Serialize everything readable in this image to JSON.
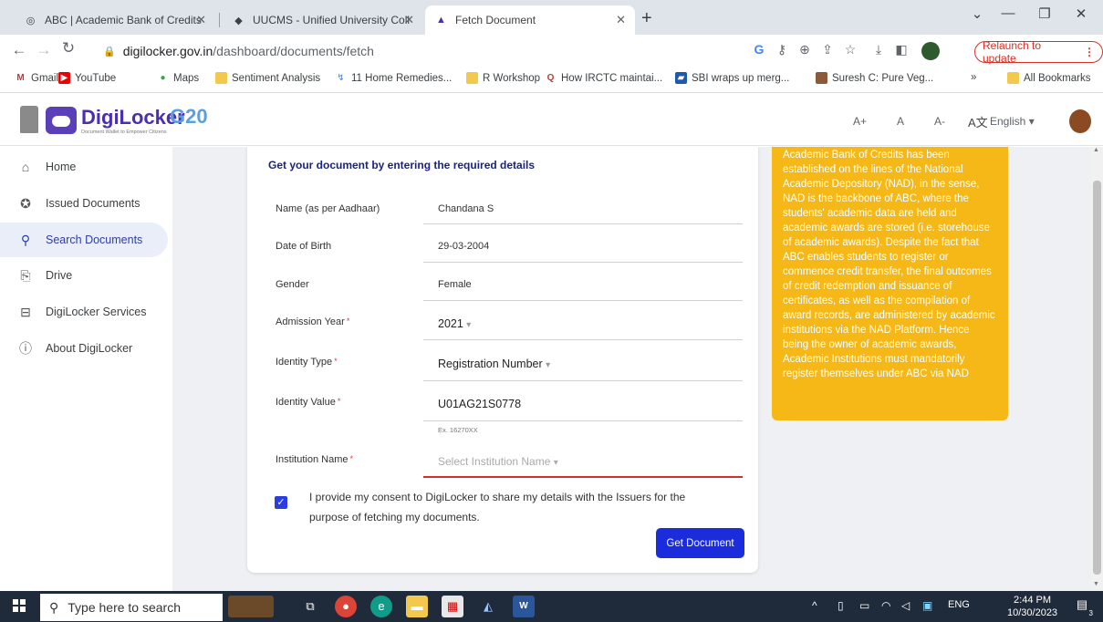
{
  "browser": {
    "tabs": [
      {
        "title": "ABC | Academic Bank of Credits"
      },
      {
        "title": "UUCMS - Unified University Coll"
      },
      {
        "title": "Fetch Document"
      }
    ],
    "url_host": "digilocker.gov.in",
    "url_path": "/dashboard/documents/fetch",
    "relaunch_label": "Relaunch to update",
    "bookmarks": [
      {
        "label": "Gmail"
      },
      {
        "label": "YouTube"
      },
      {
        "label": "Maps"
      },
      {
        "label": "Sentiment Analysis"
      },
      {
        "label": "11 Home Remedies..."
      },
      {
        "label": "R Workshop"
      },
      {
        "label": "How IRCTC maintai..."
      },
      {
        "label": "SBI wraps up merg..."
      },
      {
        "label": "Suresh C: Pure Veg..."
      }
    ],
    "all_bookmarks": "All Bookmarks",
    "bookmarks_overflow": "»"
  },
  "header": {
    "brand": "DigiLocker",
    "tagline": "Document Wallet to Empower Citizens",
    "g20": "G20",
    "font_large": "A+",
    "font_normal": "A",
    "font_small": "A-",
    "language": "English"
  },
  "sidebar": {
    "items": [
      {
        "label": "Home",
        "icon": "home-icon"
      },
      {
        "label": "Issued Documents",
        "icon": "badge-icon"
      },
      {
        "label": "Search Documents",
        "icon": "search-icon"
      },
      {
        "label": "Drive",
        "icon": "file-icon"
      },
      {
        "label": "DigiLocker Services",
        "icon": "briefcase-icon"
      },
      {
        "label": "About DigiLocker",
        "icon": "info-icon"
      }
    ],
    "active_index": 2
  },
  "form": {
    "title": "Get your document by entering the required details",
    "fields": [
      {
        "label": "Name (as per Aadhaar)",
        "value": "Chandana S",
        "required": false
      },
      {
        "label": "Date of Birth",
        "value": "29-03-2004",
        "required": false
      },
      {
        "label": "Gender",
        "value": "Female",
        "required": false
      },
      {
        "label": "Admission Year",
        "value": "2021",
        "required": true
      },
      {
        "label": "Identity Type",
        "value": "Registration Number",
        "required": true
      },
      {
        "label": "Identity Value",
        "value": "U01AG21S0778",
        "required": true
      },
      {
        "label": "Institution Name",
        "value": "",
        "required": true
      }
    ],
    "identity_hint": "Ex. 16270XX",
    "institution_placeholder": "Select Institution Name",
    "consent_text": "I provide my consent to DigiLocker to share my details with the Issuers for the purpose of fetching my documents.",
    "consent_checked": true,
    "submit_label": "Get Document"
  },
  "info": {
    "text": "Academic Bank of Credits has been established on the lines of the National Academic Depository (NAD), in the sense, NAD is the backbone of ABC, where the students' academic data are held and academic awards are stored (i.e. storehouse of academic awards). Despite the fact that ABC enables students to register or commence credit transfer, the final outcomes of credit redemption and issuance of certificates, as well as the compilation of award records, are administered by academic institutions via the NAD Platform. Hence being the owner of academic awards, Academic Institutions must mandatorily register themselves under ABC via NAD"
  },
  "taskbar": {
    "search_placeholder": "Type here to search",
    "language": "ENG",
    "time": "2:44 PM",
    "date": "10/30/2023",
    "notification_count": "3"
  },
  "colors": {
    "brand_purple": "#4a2fb0",
    "button_blue": "#1a2cdc",
    "info_yellow": "#f5b816",
    "error_red": "#d32f2f"
  }
}
